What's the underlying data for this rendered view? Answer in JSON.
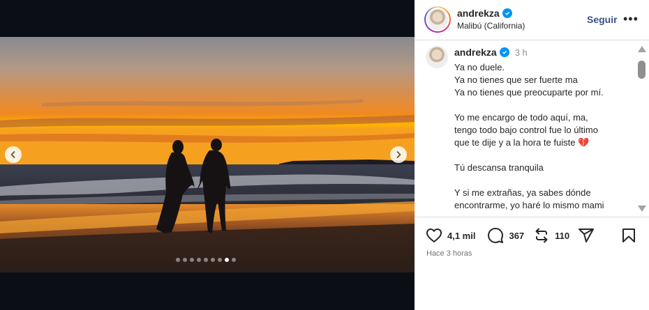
{
  "post": {
    "username": "andrekza",
    "location": "Malibú (California)",
    "follow_label": "Seguir",
    "more_label": "•••",
    "time_short": "3 h",
    "caption_lines": [
      "Ya no duele.",
      "Ya no tienes que ser fuerte ma",
      "Ya no tienes que preocuparte por mí.",
      "",
      "Yo me encargo de todo aquí, ma,",
      "tengo todo bajo control fue lo último",
      "que te dije y a la hora te fuiste 💔",
      "",
      "Tú descansa tranquila",
      "",
      "Y si me extrañas, ya sabes dónde",
      "encontrarme, yo haré lo mismo mami"
    ],
    "likes": "4,1 mil",
    "comments": "367",
    "reposts": "110",
    "time_ago": "Hace 3 horas"
  },
  "carousel": {
    "slide_count": 9,
    "active_index": 7
  },
  "icons": {
    "verified": "verified-badge-icon",
    "like": "heart-icon",
    "comment": "comment-bubble-icon",
    "repost": "repost-icon",
    "share": "send-icon",
    "save": "bookmark-icon",
    "prev": "chevron-left-icon",
    "next": "chevron-right-icon"
  },
  "colors": {
    "accent_blue": "#0095f6",
    "follow_text": "#385185"
  }
}
